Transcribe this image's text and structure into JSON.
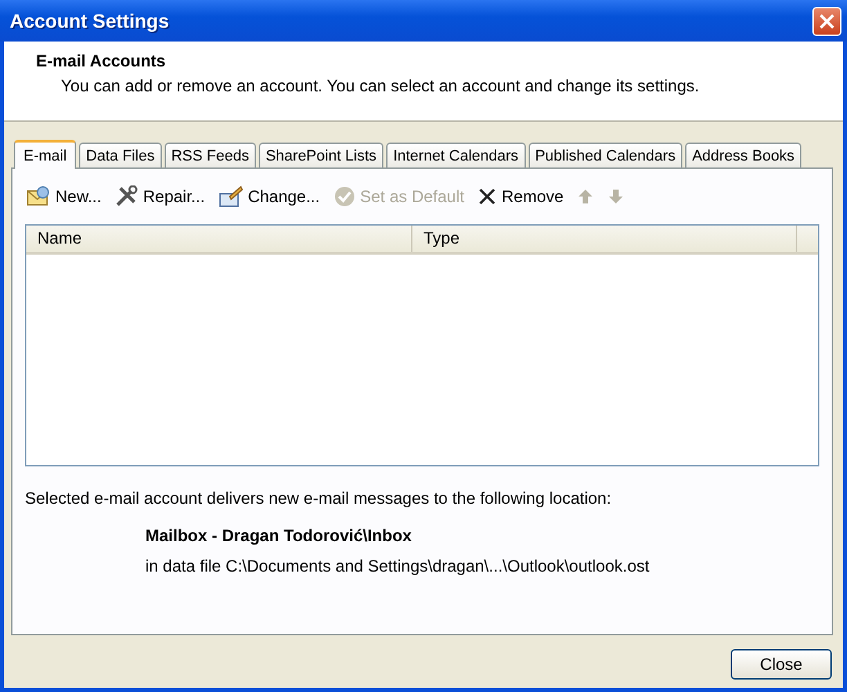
{
  "window": {
    "title": "Account Settings"
  },
  "header": {
    "title": "E-mail Accounts",
    "description": "You can add or remove an account. You can select an account and change its settings."
  },
  "tabs": [
    {
      "label": "E-mail",
      "selected": true
    },
    {
      "label": "Data Files",
      "selected": false
    },
    {
      "label": "RSS Feeds",
      "selected": false
    },
    {
      "label": "SharePoint Lists",
      "selected": false
    },
    {
      "label": "Internet Calendars",
      "selected": false
    },
    {
      "label": "Published Calendars",
      "selected": false
    },
    {
      "label": "Address Books",
      "selected": false
    }
  ],
  "toolbar": [
    {
      "kind": "new",
      "label": "New...",
      "disabled": false
    },
    {
      "kind": "repair",
      "label": "Repair...",
      "disabled": false
    },
    {
      "kind": "change",
      "label": "Change...",
      "disabled": false
    },
    {
      "kind": "default",
      "label": "Set as Default",
      "disabled": true
    },
    {
      "kind": "remove",
      "label": "Remove",
      "disabled": false
    },
    {
      "kind": "up",
      "disabled": true
    },
    {
      "kind": "down",
      "disabled": true
    }
  ],
  "table": {
    "columns": [
      "Name",
      "Type"
    ]
  },
  "delivery": {
    "text": "Selected e-mail account delivers new e-mail messages to the following location:",
    "mailbox": "Mailbox - Dragan Todorović\\Inbox",
    "data_file": "in data file C:\\Documents and Settings\\dragan\\...\\Outlook\\outlook.ost"
  },
  "buttons": [
    "Close"
  ]
}
